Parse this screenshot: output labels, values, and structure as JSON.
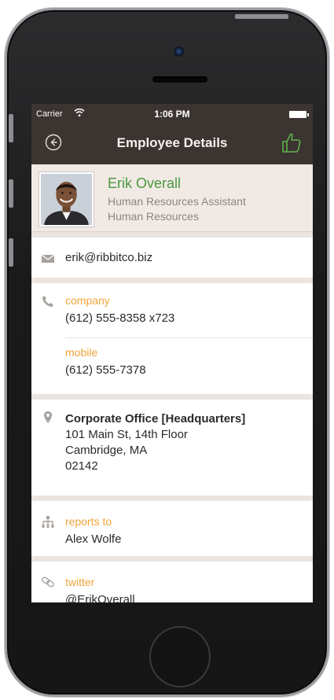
{
  "status_bar": {
    "carrier": "Carrier",
    "time": "1:06 PM"
  },
  "nav": {
    "title": "Employee Details"
  },
  "employee": {
    "name": "Erik Overall",
    "title": "Human Resources Assistant",
    "department": "Human Resources"
  },
  "email": "erik@ribbitco.biz",
  "phones": [
    {
      "label": "company",
      "number": "(612) 555-8358 x723"
    },
    {
      "label": "mobile",
      "number": "(612) 555-7378"
    }
  ],
  "address": {
    "name": "Corporate Office [Headquarters]",
    "street": "101 Main St, 14th Floor",
    "city": "Cambridge, MA",
    "zip": "02142"
  },
  "reports_to": {
    "label": "reports to",
    "name": "Alex Wolfe"
  },
  "twitter": {
    "label": "twitter",
    "handle": "@ErikOverall"
  },
  "icons": [
    "back-icon",
    "thumbs-up-icon",
    "mail-icon",
    "phone-icon",
    "location-pin-icon",
    "org-chart-icon",
    "link-icon",
    "wifi-icon",
    "battery-icon"
  ],
  "colors": {
    "topbar": "#3b3431",
    "accent_green": "#4a9a3e",
    "label_orange": "#f0a53a",
    "profile_bg": "#f1e9e4"
  }
}
